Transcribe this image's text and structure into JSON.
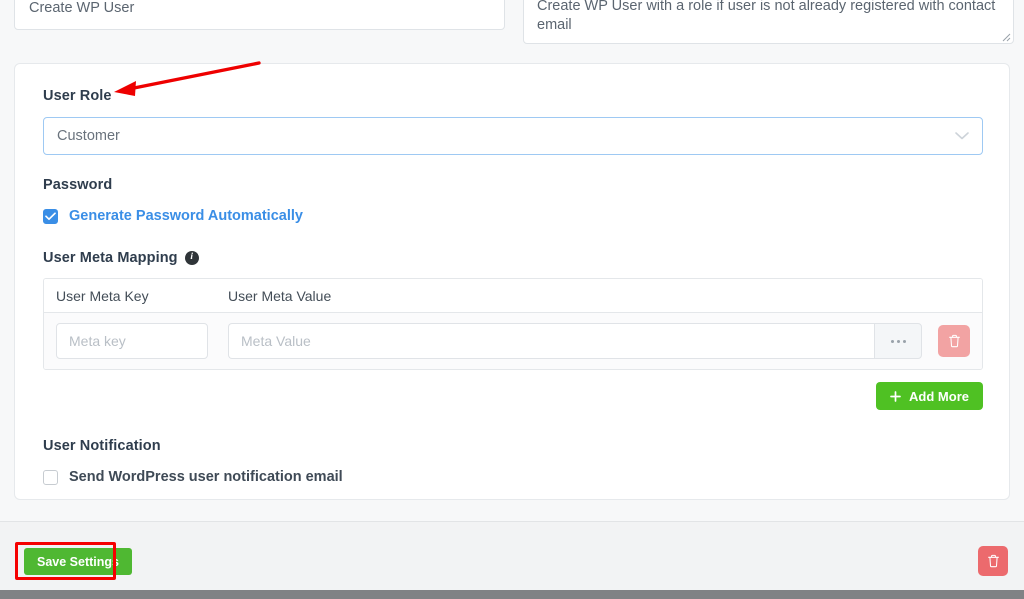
{
  "top": {
    "title_value": "Create WP User",
    "description_value": "Create WP User with a role if user is not already registered with contact email"
  },
  "form": {
    "user_role": {
      "label": "User Role",
      "selected": "Customer",
      "chevron_icon": "chevron-down-icon"
    },
    "password": {
      "label": "Password",
      "generate_checkbox_label": "Generate Password Automatically",
      "generate_checked": true
    },
    "meta_mapping": {
      "label": "User Meta Mapping",
      "info_icon": "info-icon",
      "info_glyph": "i",
      "columns": [
        "User Meta Key",
        "User Meta Value"
      ],
      "rows": [
        {
          "key_value": "",
          "key_placeholder": "Meta key",
          "value_value": "",
          "value_placeholder": "Meta Value",
          "more_icon": "ellipsis-icon",
          "delete_icon": "trash-icon"
        }
      ],
      "add_more_label": "Add More",
      "add_more_icon": "plus-icon"
    },
    "notification": {
      "label": "User Notification",
      "send_email_label": "Send WordPress user notification email",
      "send_email_checked": false
    }
  },
  "footer": {
    "save_label": "Save Settings",
    "delete_icon": "trash-icon"
  },
  "annotation": {
    "arrow_color": "#ee0000",
    "highlight_color": "#f50000"
  },
  "colors": {
    "accent_blue": "#3a8ee6",
    "green": "#4fc123",
    "danger": "#ec6a6d",
    "page_bg": "#f7f8f9"
  }
}
